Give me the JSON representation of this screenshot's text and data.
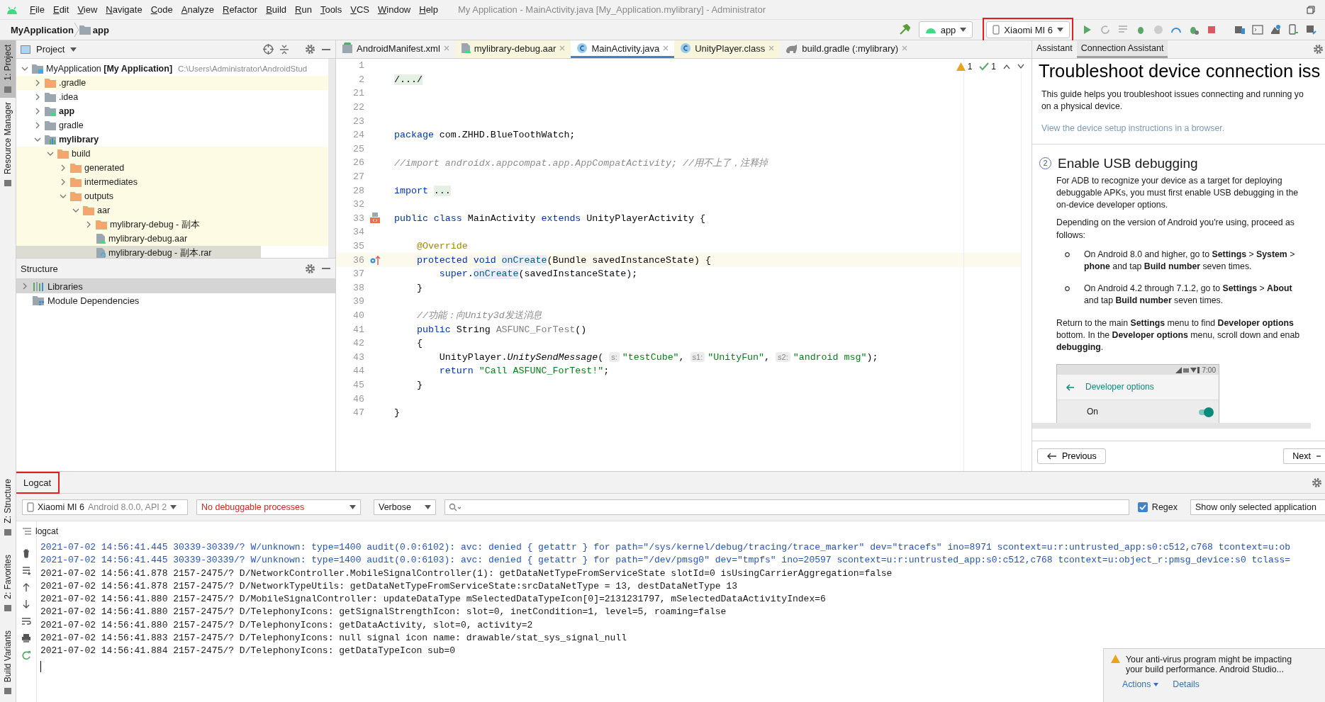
{
  "menu_bar": {
    "items": [
      "File",
      "Edit",
      "View",
      "Navigate",
      "Code",
      "Analyze",
      "Refactor",
      "Build",
      "Run",
      "Tools",
      "VCS",
      "Window",
      "Help"
    ],
    "title": "My Application - MainActivity.java [My_Application.mylibrary] - Administrator"
  },
  "nav_bar": {
    "breadcrumbs": [
      "MyApplication",
      "app"
    ],
    "run_config": "app",
    "device": {
      "label": "Xiaomi MI 6",
      "annotated": true
    }
  },
  "left_strip": {
    "top": [
      {
        "label": "1: Project",
        "selected": true
      },
      {
        "label": "Resource Manager",
        "selected": false
      }
    ],
    "bottom": [
      {
        "label": "Z: Structure",
        "selected": false
      },
      {
        "label": "2: Favorites",
        "selected": false
      },
      {
        "label": "Build Variants",
        "selected": false
      }
    ]
  },
  "project": {
    "title": "Project",
    "tree": [
      {
        "label": "MyApplication **[My Application]**",
        "path": "C:\\Users\\Administrator\\AndroidStud",
        "kind": "project",
        "expanded": true,
        "excluded": false,
        "selected": false,
        "children": [
          {
            "label": ".gradle",
            "kind": "folder",
            "expanded": false,
            "excluded": true,
            "selected": false
          },
          {
            "label": ".idea",
            "kind": "folder",
            "expanded": false,
            "excluded": false,
            "selected": false
          },
          {
            "label": "app",
            "kind": "module",
            "expanded": false,
            "excluded": false,
            "selected": false
          },
          {
            "label": "gradle",
            "kind": "folder",
            "expanded": false,
            "excluded": false,
            "selected": false
          },
          {
            "label": "mylibrary",
            "kind": "library",
            "expanded": true,
            "excluded": false,
            "selected": false,
            "children": [
              {
                "label": "build",
                "kind": "folder",
                "expanded": true,
                "excluded": true,
                "selected": false,
                "children": [
                  {
                    "label": "generated",
                    "kind": "folder",
                    "expanded": false,
                    "excluded": true,
                    "selected": false
                  },
                  {
                    "label": "intermediates",
                    "kind": "folder",
                    "expanded": false,
                    "excluded": true,
                    "selected": false
                  },
                  {
                    "label": "outputs",
                    "kind": "folder",
                    "expanded": true,
                    "excluded": true,
                    "selected": false,
                    "children": [
                      {
                        "label": "aar",
                        "kind": "folder",
                        "expanded": true,
                        "excluded": true,
                        "selected": false,
                        "children": [
                          {
                            "label": "mylibrary-debug - 副本",
                            "kind": "folder",
                            "expanded": false,
                            "excluded": true,
                            "selected": false
                          },
                          {
                            "label": "mylibrary-debug.aar",
                            "kind": "aar",
                            "excluded": true,
                            "selected": false
                          },
                          {
                            "label": "mylibrary-debug - 副本.rar",
                            "kind": "archive",
                            "excluded": true,
                            "selected": true
                          }
                        ]
                      }
                    ]
                  }
                ]
              }
            ]
          }
        ]
      }
    ]
  },
  "structure": {
    "title": "Structure",
    "items": [
      {
        "label": "Libraries",
        "kind": "libraries",
        "expanded": false,
        "selected": true
      },
      {
        "label": "Module Dependencies",
        "kind": "dependencies",
        "selected": false
      }
    ]
  },
  "editor": {
    "tabs": [
      {
        "label": "AndroidManifest.xml",
        "kind": "manifest",
        "selected": false,
        "excluded": false
      },
      {
        "label": "mylibrary-debug.aar",
        "kind": "aar",
        "selected": false,
        "excluded": true
      },
      {
        "label": "MainActivity.java",
        "kind": "class",
        "selected": true,
        "excluded": false
      },
      {
        "label": "UnityPlayer.class",
        "kind": "class",
        "selected": false,
        "excluded": true
      },
      {
        "label": "build.gradle (:mylibrary)",
        "kind": "gradle",
        "selected": false,
        "excluded": false
      }
    ],
    "inspections": {
      "warnings": "1",
      "passed": "1"
    },
    "lines": [
      {
        "number": "1",
        "current": false
      },
      {
        "number": "2",
        "current": false,
        "tokens": [
          {
            "kind": "fold",
            "text": "/.../"
          }
        ]
      },
      {
        "number": "21",
        "current": false
      },
      {
        "number": "22",
        "current": false
      },
      {
        "number": "23",
        "current": false
      },
      {
        "number": "24",
        "current": false,
        "tokens": [
          {
            "kind": "keyword",
            "text": "package"
          },
          {
            "kind": "plain",
            "text": " com.ZHHD.BlueToothWatch;"
          }
        ]
      },
      {
        "number": "25",
        "current": false
      },
      {
        "number": "26",
        "current": false,
        "tokens": [
          {
            "kind": "comment",
            "text": "//import androidx.appcompat.app.AppCompatActivity; //用不上了，注释掉"
          }
        ]
      },
      {
        "number": "27",
        "current": false
      },
      {
        "number": "28",
        "current": false,
        "tokens": [
          {
            "kind": "keyword",
            "text": "import "
          },
          {
            "kind": "fold",
            "text": "..."
          }
        ]
      },
      {
        "number": "32",
        "current": false
      },
      {
        "number": "33",
        "current": false,
        "kind": "implemented",
        "tokens": [
          {
            "kind": "keyword",
            "text": "public class"
          },
          {
            "kind": "plain",
            "text": " MainActivity "
          },
          {
            "kind": "keyword",
            "text": "extends"
          },
          {
            "kind": "plain",
            "text": " UnityPlayerActivity {"
          }
        ]
      },
      {
        "number": "34",
        "current": false
      },
      {
        "number": "35",
        "current": false,
        "tokens": [
          {
            "kind": "annotation",
            "text": "    @Override"
          }
        ]
      },
      {
        "number": "36",
        "current": true,
        "kind": "overrides",
        "tokens": [
          {
            "kind": "keyword",
            "text": "    protected void "
          },
          {
            "kind": "usage",
            "text": "onCreate"
          },
          {
            "kind": "plain",
            "text": "(Bundle savedInstanceState) {"
          }
        ]
      },
      {
        "number": "37",
        "current": false,
        "tokens": [
          {
            "kind": "keyword",
            "text": "        super"
          },
          {
            "kind": "plain",
            "text": "."
          },
          {
            "kind": "usage",
            "text": "onCreate"
          },
          {
            "kind": "plain",
            "text": "(savedInstanceState);"
          }
        ]
      },
      {
        "number": "38",
        "current": false,
        "tokens": [
          {
            "kind": "plain",
            "text": "    }"
          }
        ]
      },
      {
        "number": "39",
        "current": false
      },
      {
        "number": "40",
        "current": false,
        "tokens": [
          {
            "kind": "comment",
            "text": "    //功能：向Unity3d发送消息"
          }
        ]
      },
      {
        "number": "41",
        "current": false,
        "tokens": [
          {
            "kind": "keyword",
            "text": "    public"
          },
          {
            "kind": "plain",
            "text": " String "
          },
          {
            "kind": "unused",
            "text": "ASFUNC_ForTest"
          },
          {
            "kind": "plain",
            "text": "()"
          }
        ]
      },
      {
        "number": "42",
        "current": false,
        "tokens": [
          {
            "kind": "plain",
            "text": "    {"
          }
        ]
      },
      {
        "number": "43",
        "current": false,
        "tokens": [
          {
            "kind": "plain",
            "text": "        UnityPlayer."
          },
          {
            "kind": "static",
            "text": "UnitySendMessage"
          },
          {
            "kind": "plain",
            "text": "( "
          },
          {
            "kind": "hint",
            "text": "s:"
          },
          {
            "kind": "string",
            "text": "\"testCube\""
          },
          {
            "kind": "plain",
            "text": ", "
          },
          {
            "kind": "hint",
            "text": "s1:"
          },
          {
            "kind": "string",
            "text": "\"UnityFun\""
          },
          {
            "kind": "plain",
            "text": ", "
          },
          {
            "kind": "hint",
            "text": "s2:"
          },
          {
            "kind": "string",
            "text": "\"android msg\""
          },
          {
            "kind": "plain",
            "text": ");"
          }
        ]
      },
      {
        "number": "44",
        "current": false,
        "tokens": [
          {
            "kind": "keyword",
            "text": "        return "
          },
          {
            "kind": "string",
            "text": "\"Call ASFUNC_ForTest!\""
          },
          {
            "kind": "plain",
            "text": ";"
          }
        ]
      },
      {
        "number": "45",
        "current": false,
        "tokens": [
          {
            "kind": "plain",
            "text": "    }"
          }
        ]
      },
      {
        "number": "46",
        "current": false
      },
      {
        "number": "47",
        "current": false,
        "tokens": [
          {
            "kind": "plain",
            "text": "}"
          }
        ]
      }
    ]
  },
  "assistant": {
    "tabs": [
      {
        "label": "Assistant",
        "selected": false
      },
      {
        "label": "Connection Assistant",
        "selected": true
      }
    ],
    "title": "Troubleshoot device connection iss",
    "intro": [
      "This guide helps you troubleshoot issues connecting and running yo",
      "on a physical device."
    ],
    "link": "View the device setup instructions in a browser.",
    "step": {
      "number": "2",
      "title": "Enable USB debugging",
      "paragraphs": [
        [
          "For ADB to recognize your device as a target for deploying",
          "debuggable APKs, you must first enable USB debugging in the",
          "on-device developer options."
        ],
        [
          "Depending on the version of Android you're using, proceed as",
          "follows:"
        ]
      ],
      "bullets": [
        [
          "On Android 8.0 and higher, go to **Settings** > **System** >",
          "**phone** and tap **Build number** seven times."
        ],
        [
          "On Android 4.2 through 7.1.2, go to **Settings** > **About**",
          "and tap **Build number** seven times."
        ]
      ],
      "closing": [
        "Return to the main **Settings** menu to find **Developer options**",
        "bottom. In the **Developer options** menu, scroll down and enab",
        "**debugging**."
      ],
      "phone": {
        "time": "7:00",
        "screen_title": "Developer options",
        "row_label": "On",
        "toggle_on": true
      }
    },
    "buttons": [
      "Previous",
      "Next"
    ]
  },
  "logcat": {
    "title": "Logcat",
    "annotated": true,
    "device": "Xiaomi MI 6",
    "device_detail": "Android 8.0.0, API 2",
    "process": "No debuggable processes",
    "level": "Verbose",
    "regex": {
      "label": "Regex",
      "checked": true
    },
    "filter": "Show only selected application",
    "section": "logcat",
    "lines": [
      {
        "kind": "warn",
        "text": "2021-07-02 14:56:41.445 30339-30339/? W/unknown: type=1400 audit(0.0:6102): avc: denied { getattr } for path=\"/sys/kernel/debug/tracing/trace_marker\" dev=\"tracefs\" ino=8971 scontext=u:r:untrusted_app:s0:c512,c768 tcontext=u:ob"
      },
      {
        "kind": "warn",
        "text": "2021-07-02 14:56:41.445 30339-30339/? W/unknown: type=1400 audit(0.0:6103): avc: denied { getattr } for path=\"/dev/pmsg0\" dev=\"tmpfs\" ino=20597 scontext=u:r:untrusted_app:s0:c512,c768 tcontext=u:object_r:pmsg_device:s0 tclass="
      },
      {
        "kind": "debug",
        "text": "2021-07-02 14:56:41.878 2157-2475/? D/NetworkController.MobileSignalController(1): getDataNetTypeFromServiceState slotId=0  isUsingCarrierAggregation=false"
      },
      {
        "kind": "debug",
        "text": "2021-07-02 14:56:41.878 2157-2475/? D/NetworkTypeUtils: getDataNetTypeFromServiceState:srcDataNetType = 13, destDataNetType 13"
      },
      {
        "kind": "debug",
        "text": "2021-07-02 14:56:41.880 2157-2475/? D/MobileSignalController: updateDataType mSelectedDataTypeIcon[0]=2131231797, mSelectedDataActivityIndex=6"
      },
      {
        "kind": "debug",
        "text": "2021-07-02 14:56:41.880 2157-2475/? D/TelephonyIcons: getSignalStrengthIcon: slot=0, inetCondition=1, level=5, roaming=false"
      },
      {
        "kind": "debug",
        "text": "2021-07-02 14:56:41.880 2157-2475/? D/TelephonyIcons: getDataActivity, slot=0, activity=2"
      },
      {
        "kind": "debug",
        "text": "2021-07-02 14:56:41.883 2157-2475/? D/TelephonyIcons: null signal icon name: drawable/stat_sys_signal_null"
      },
      {
        "kind": "debug",
        "text": "2021-07-02 14:56:41.884 2157-2475/? D/TelephonyIcons: getDataTypeIcon sub=0"
      }
    ]
  },
  "notification": {
    "kind": "warning",
    "text": [
      "Your anti-virus program might be impacting",
      "your build performance. Android Studio..."
    ],
    "actions": [
      "Actions",
      "Details"
    ]
  }
}
